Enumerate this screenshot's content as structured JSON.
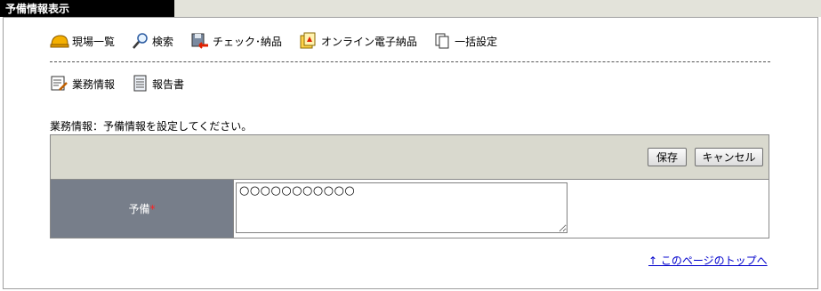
{
  "window": {
    "title": "予備情報表示"
  },
  "toolbar1": [
    {
      "label": "現場一覧",
      "icon": "helmet-icon"
    },
    {
      "label": "検索",
      "icon": "magnifier-icon"
    },
    {
      "label": "チェック･納品",
      "icon": "floppy-check-icon"
    },
    {
      "label": "オンライン電子納品",
      "icon": "online-delivery-icon"
    },
    {
      "label": "一括設定",
      "icon": "documents-icon"
    }
  ],
  "toolbar2": [
    {
      "label": "業務情報",
      "icon": "task-edit-icon"
    },
    {
      "label": "報告書",
      "icon": "report-icon"
    }
  ],
  "message": "業務情報：予備情報を設定してください。",
  "buttons": {
    "save": "保存",
    "cancel": "キャンセル"
  },
  "form": {
    "field_label": "予備",
    "required_mark": "*",
    "field_value": "○○○○○○○○○○○"
  },
  "page_top_link": "↑ このページのトップへ",
  "colors": {
    "title_bg": "#000000",
    "header_band": "#d9d9ce",
    "label_bg": "#777e8a",
    "link": "#0000cc",
    "required": "#ff2020"
  }
}
